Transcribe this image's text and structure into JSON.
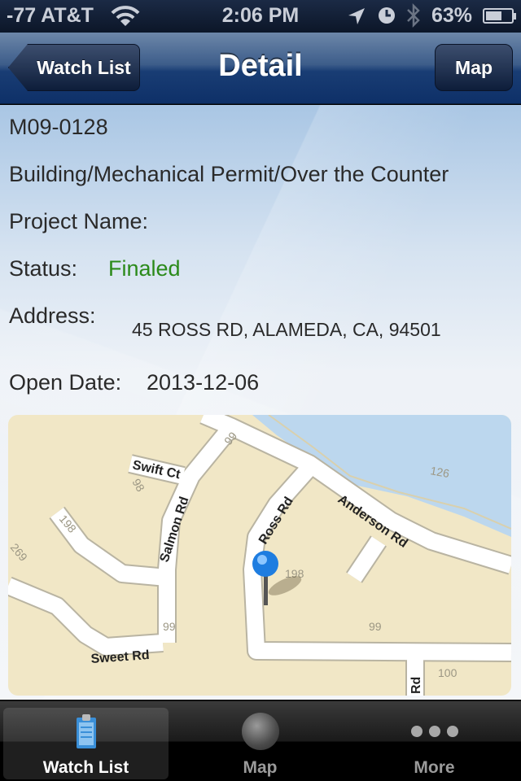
{
  "status_bar": {
    "carrier": "-77 AT&T",
    "time": "2:06 PM",
    "battery_percent_label": "63%",
    "battery_level": 0.63,
    "icons": [
      "wifi-icon",
      "location-arrow-icon",
      "alarm-clock-icon",
      "bluetooth-icon",
      "battery-icon"
    ]
  },
  "nav_bar": {
    "title": "Detail",
    "back_label": "Watch List",
    "right_label": "Map"
  },
  "detail": {
    "permit_number": "M09-0128",
    "permit_type": "Building/Mechanical Permit/Over the Counter",
    "project_name_label": "Project Name:",
    "project_name_value": "",
    "status_label": "Status:",
    "status_value": "Finaled",
    "status_color": "#2b8a1a",
    "address_label": "Address:",
    "address_value": "45 ROSS RD, ALAMEDA, CA, 94501",
    "open_date_label": "Open Date:",
    "open_date_value": "2013-12-06"
  },
  "map": {
    "street_labels": [
      "Swift Ct",
      "Salmon Rd",
      "Ross Rd",
      "Anderson Rd",
      "Sweet Rd",
      "Rd"
    ],
    "parcel_numbers": [
      "99",
      "98",
      "198",
      "269",
      "126",
      "198",
      "99",
      "99",
      "100"
    ],
    "pin": "blue-pin-icon",
    "colors": {
      "land": "#f1e7c6",
      "water": "#bcd7ee",
      "road": "#ffffff"
    }
  },
  "tab_bar": {
    "tabs": [
      {
        "label": "Watch List",
        "icon": "clipboard-icon",
        "active": true
      },
      {
        "label": "Map",
        "icon": "globe-icon",
        "active": false
      },
      {
        "label": "More",
        "icon": "more-dots-icon",
        "active": false
      }
    ]
  }
}
